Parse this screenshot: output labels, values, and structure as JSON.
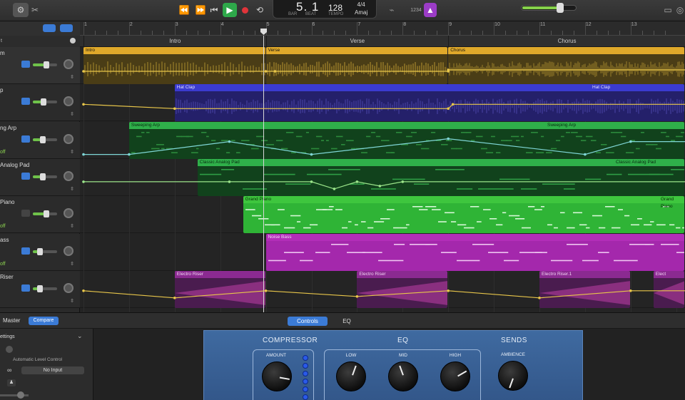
{
  "toolbar": {
    "display_main": "5. 1",
    "display_bar_label": "BAR",
    "display_beat_label": "BEAT",
    "tempo": "128",
    "tempo_label": "TEMPO",
    "time_signature": "4/4",
    "key": "Amaj",
    "count_in": "1234",
    "master_volume": 0.68
  },
  "track_header": {
    "title_cut": "t"
  },
  "tracks": [
    {
      "name": "m",
      "automation": "",
      "volume": 0.55
    },
    {
      "name": "p",
      "automation": "",
      "volume": 0.45
    },
    {
      "name": "ng Arp",
      "automation": "off",
      "volume": 0.42
    },
    {
      "name": "Analog Pad",
      "automation": "",
      "volume": 0.4
    },
    {
      "name": "Piano",
      "automation": "off",
      "volume": 0.55
    },
    {
      "name": "ass",
      "automation": "off",
      "volume": 0.28
    },
    {
      "name": "Riser",
      "automation": "",
      "volume": 0.3
    }
  ],
  "ruler": {
    "bars": [
      "1",
      "2",
      "3",
      "4",
      "5",
      "6",
      "7",
      "8",
      "9",
      "10",
      "11",
      "12",
      "13"
    ]
  },
  "arrangement": [
    {
      "label": "Intro"
    },
    {
      "label": "Verse"
    },
    {
      "label": "Chorus"
    }
  ],
  "regions": {
    "drums": [
      "Intro",
      "Verse",
      "Chorus"
    ],
    "hatclap": [
      "Hat Clap",
      "Hat Clap"
    ],
    "arp": [
      "Sweeping Arp",
      "Sweeping Arp"
    ],
    "pad": [
      "Classic Analog Pad",
      "Classic Analog Pad"
    ],
    "piano": [
      "Grand Piano",
      "Grand Piano"
    ],
    "bass": [
      "Noise Bass"
    ],
    "riser": [
      "Electro Riser",
      "Electro Riser",
      "Electro Riser.1",
      "Elect"
    ]
  },
  "smart_controls": {
    "master_tab": "Master",
    "compare_button": "Compare",
    "tabs": [
      "Controls",
      "EQ"
    ],
    "settings_label": "ettings",
    "auto_level_label": "Automatic Level Control",
    "input_value": "No Input",
    "sections": {
      "compressor": "COMPRESSOR",
      "eq": "EQ",
      "sends": "SENDS"
    },
    "knobs": {
      "amount": "AMOUNT",
      "low": "LOW",
      "mid": "MID",
      "high": "HIGH",
      "ambience": "AMBIENCE"
    }
  },
  "colors": {
    "accent_blue": "#3b7bd6",
    "play_green": "#2ea84a",
    "record_red": "#e0343a",
    "drums_yellow": "#e0a92a",
    "region_blue": "#3b3bd0",
    "region_green": "#2fb04a",
    "region_purple": "#b32eb8"
  }
}
